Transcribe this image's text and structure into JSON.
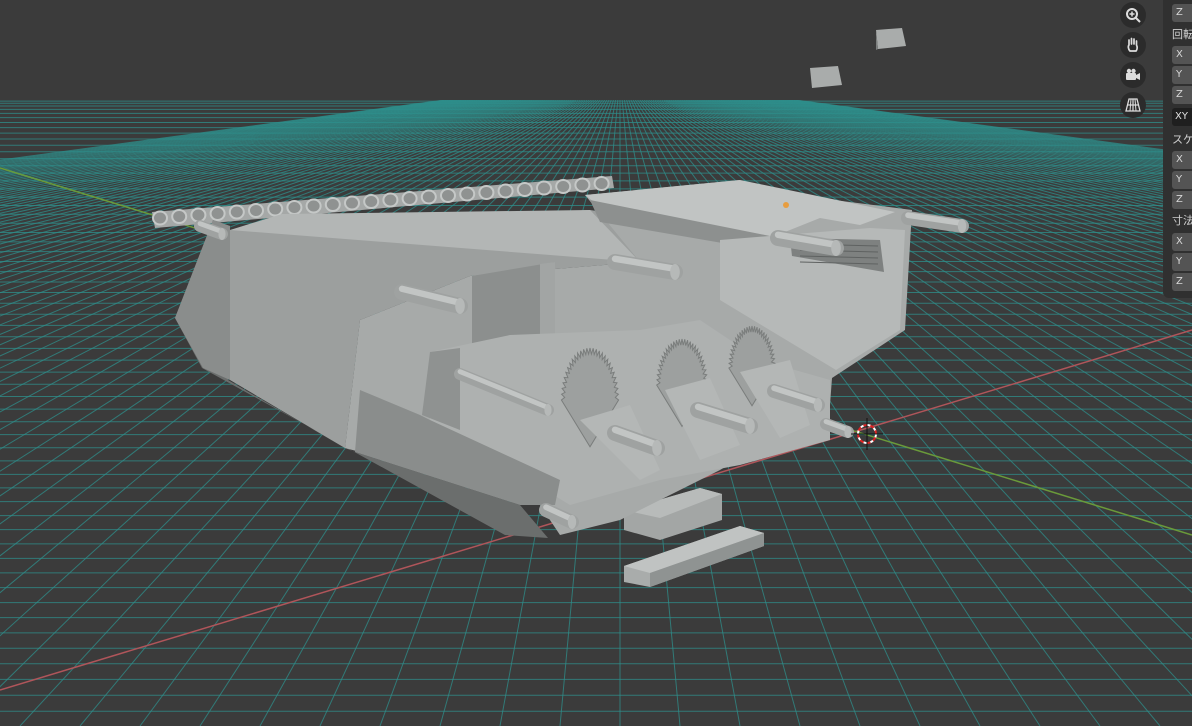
{
  "viewport": {
    "grid_color": "#2e8f8c",
    "x_axis_color": "#b0555a",
    "y_axis_color": "#6a9a3a",
    "background": "#3d3d3d",
    "model_color": "#9ea2a1"
  },
  "nav_gizmo": {
    "icons": [
      "zoom-icon",
      "pan-hand-icon",
      "camera-icon",
      "grid-perspective-icon"
    ]
  },
  "sidebar": {
    "loc_z": "Z",
    "rotation_label": "回転",
    "rot_x": "X",
    "rot_y": "Y",
    "rot_z": "Z",
    "rotation_mode": "XY",
    "scale_label": "スケ",
    "scale_x": "X",
    "scale_y": "Y",
    "scale_z": "Z",
    "dimensions_label": "寸法",
    "dim_x": "X",
    "dim_y": "Y",
    "dim_z": "Z"
  }
}
